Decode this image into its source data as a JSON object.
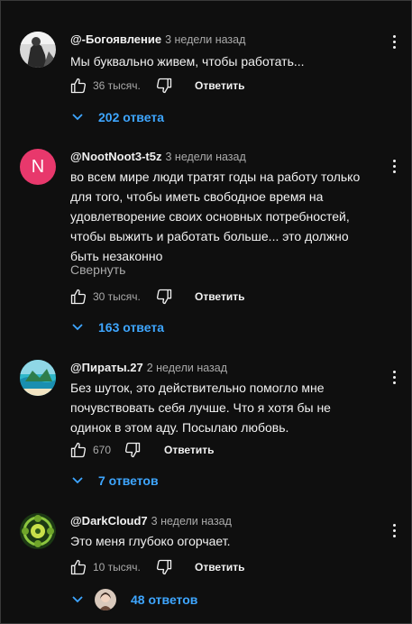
{
  "comments": [
    {
      "author": "@-Богоявление",
      "time": "3 недели назад",
      "text": "Мы буквально живем, чтобы работать...",
      "likes": "36 тысяч.",
      "reply_label": "Ответить",
      "replies_label": "202 ответа"
    },
    {
      "author": "@NootNoot3-t5z",
      "time": "3 недели назад",
      "avatar_letter": "N",
      "avatar_color": "#e8386c",
      "text": "во всем мире люди тратят годы на работу только\nдля того, чтобы иметь свободное время на\nудовлетворение своих основных потребностей,\nчтобы выжить и работать больше... это должно\nбыть незаконно",
      "collapse_label": "Свернуть",
      "likes": "30 тысяч.",
      "reply_label": "Ответить",
      "replies_label": "163 ответа"
    },
    {
      "author": "@Пираты.27",
      "time": "2 недели назад",
      "text": "Без шуток, это действительно помогло мне\nпочувствовать себя лучше. Что я хотя бы не\nодинок в этом аду. Посылаю любовь.",
      "likes": "670",
      "reply_label": "Ответить",
      "replies_label": "7 ответов"
    },
    {
      "author": "@DarkCloud7",
      "time": "3 недели назад",
      "text": "Это меня глубоко огорчает.",
      "likes": "10 тысяч.",
      "reply_label": "Ответить",
      "replies_label": "48 ответов"
    }
  ],
  "colors": {
    "accent": "#3ea6ff",
    "background": "#0f0f0f",
    "muted": "#aaaaaa"
  },
  "icons": [
    "more-vert-icon",
    "thumb-up-icon",
    "thumb-down-icon",
    "chevron-down-icon"
  ]
}
